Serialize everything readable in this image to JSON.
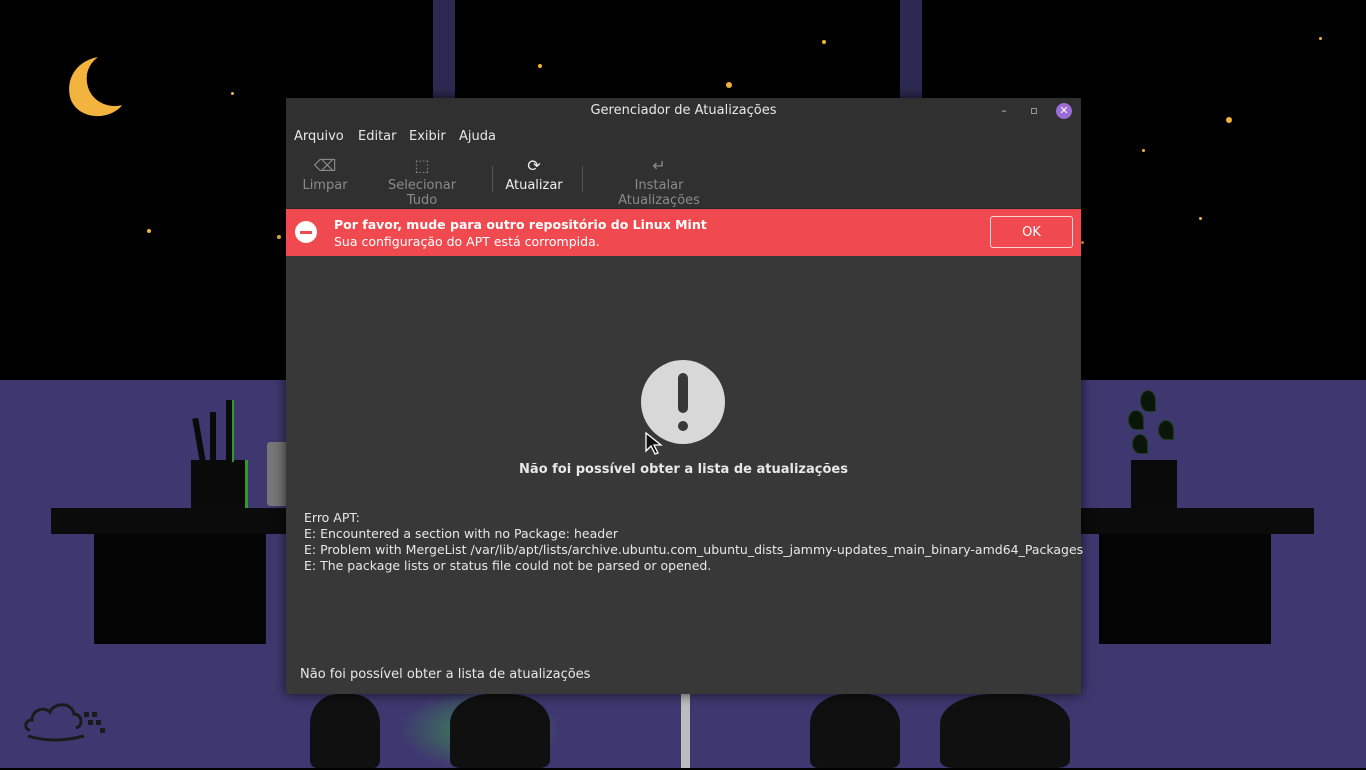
{
  "window": {
    "title": "Gerenciador de Atualizações",
    "controls": {
      "minimize": "–",
      "maximize": "▫",
      "close": "✕"
    }
  },
  "menubar": {
    "items": [
      "Arquivo",
      "Editar",
      "Exibir",
      "Ajuda"
    ]
  },
  "toolbar": {
    "clear": {
      "label": "Limpar",
      "icon": "backspace-icon",
      "enabled": false
    },
    "select_all": {
      "label": "Selecionar Tudo",
      "icon": "select-all-icon",
      "enabled": false
    },
    "refresh": {
      "label": "Atualizar",
      "icon": "refresh-icon",
      "enabled": true
    },
    "install": {
      "label": "Instalar Atualizações",
      "icon": "enter-icon",
      "enabled": false
    }
  },
  "infobar": {
    "title": "Por favor, mude para outro repositório do Linux Mint",
    "subtitle": "Sua configuração do APT está corrompida.",
    "ok_label": "OK",
    "color": "#f04a50"
  },
  "error": {
    "heading": "Não foi possível obter a lista de atualizações",
    "lines": [
      "Erro APT:",
      "E: Encountered a section with no Package: header",
      "E: Problem with MergeList /var/lib/apt/lists/archive.ubuntu.com_ubuntu_dists_jammy-updates_main_binary-amd64_Packages",
      "E: The package lists or status file could not be parsed or opened."
    ]
  },
  "statusbar": {
    "text": "Não foi possível obter a lista de atualizações"
  },
  "colors": {
    "accent_close": "#9b6bd8",
    "window_bg": "#383838",
    "header_bg": "#303030"
  }
}
